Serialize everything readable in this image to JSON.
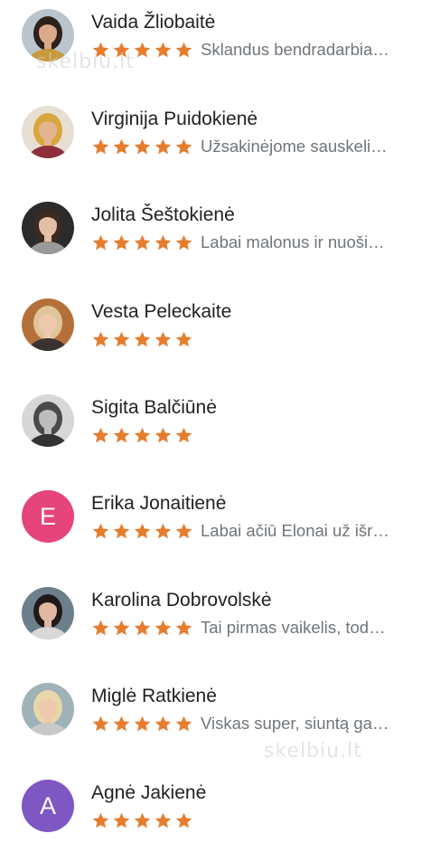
{
  "colors": {
    "star": "#e67c2e",
    "name": "#202124",
    "snippet": "#70757a",
    "background": "#ffffff"
  },
  "reviews": [
    {
      "name": "Vaida Žliobaitė",
      "stars": 5,
      "snippet": "Sklandus bendradarbia…",
      "avatar": {
        "type": "photo",
        "bg": "#b9c4cc",
        "skin": "#d9a98a",
        "hair": "#2d211b",
        "shirt": "#c99a3a"
      }
    },
    {
      "name": "Virginija Puidokienė",
      "stars": 5,
      "snippet": "Užsakinėjome sauskeli…",
      "avatar": {
        "type": "photo",
        "bg": "#e7e0d2",
        "skin": "#e2b48f",
        "hair": "#d7a63c",
        "shirt": "#8f2f3d"
      }
    },
    {
      "name": "Jolita Šeštokienė",
      "stars": 5,
      "snippet": "Labai malonus ir nuoši…",
      "avatar": {
        "type": "photo",
        "bg": "#2c2a2a",
        "skin": "#e4bfa6",
        "hair": "#3b2a22",
        "shirt": "#9a9a9a"
      }
    },
    {
      "name": "Vesta Peleckaite",
      "stars": 5,
      "snippet": "",
      "avatar": {
        "type": "photo",
        "bg": "#b5703a",
        "skin": "#ecc9ae",
        "hair": "#e0c49a",
        "shirt": "#3a3230"
      }
    },
    {
      "name": "Sigita Balčiūnė",
      "stars": 5,
      "snippet": "",
      "avatar": {
        "type": "photo",
        "bg": "#d7d7d7",
        "skin": "#bdbdbd",
        "hair": "#4a4a4a",
        "shirt": "#333333"
      }
    },
    {
      "name": "Erika Jonaitienė",
      "stars": 5,
      "snippet": "Labai ačiū Elonai už išr…",
      "avatar": {
        "type": "letter",
        "letter": "E",
        "bg": "#e5457b"
      }
    },
    {
      "name": "Karolina Dobrovolskė",
      "stars": 5,
      "snippet": "Tai pirmas vaikelis, tod…",
      "avatar": {
        "type": "photo",
        "bg": "#6d7f8a",
        "skin": "#e1b9a0",
        "hair": "#1f1a18",
        "shirt": "#d8d8d8"
      }
    },
    {
      "name": "Miglė Ratkienė",
      "stars": 5,
      "snippet": "Viskas super, siuntą ga…",
      "avatar": {
        "type": "photo",
        "bg": "#9fb2b8",
        "skin": "#eec9ae",
        "hair": "#e8d7a8",
        "shirt": "#c8c8c8"
      }
    },
    {
      "name": "Agnė Jakienė",
      "stars": 5,
      "snippet": "",
      "avatar": {
        "type": "letter",
        "letter": "A",
        "bg": "#7e57c2"
      }
    }
  ],
  "watermarks": [
    "skelbiu.lt",
    "skelbiu.lt"
  ]
}
